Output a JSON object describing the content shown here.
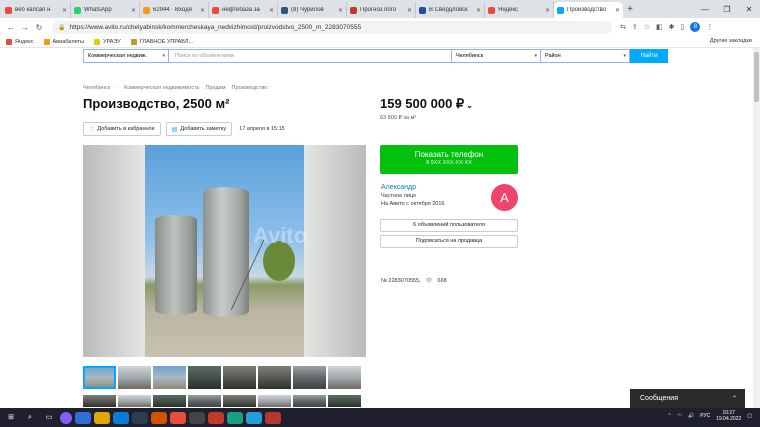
{
  "browser": {
    "tabs": [
      {
        "label": "веб капсап н",
        "color": "#e74c3c"
      },
      {
        "label": "WhatsApp",
        "color": "#25d366"
      },
      {
        "label": "62944 · Входя",
        "color": "#f39c12"
      },
      {
        "label": "нефтебаза за",
        "color": "#e74c3c"
      },
      {
        "label": "(8) Чурилов",
        "color": "#2a5885"
      },
      {
        "label": "Прогноз пого",
        "color": "#c0392b"
      },
      {
        "label": "В Свердловск",
        "color": "#1a4ea8"
      },
      {
        "label": "Яндекс",
        "color": "#e74c3c"
      },
      {
        "label": "Производство",
        "color": "#00aaff",
        "active": true
      }
    ],
    "new_tab": "+",
    "url": "https://www.avito.ru/chelyabinsk/kommercheskaya_nedvizhimost/proizvodstvo_2500_m_2283070555",
    "profile_letter": "8",
    "bookmarks": [
      {
        "label": "Яндекс",
        "color": "#e74c3c"
      },
      {
        "label": "Авиабилеты",
        "color": "#f39c12"
      },
      {
        "label": "УРАЭУ",
        "color": "#f1c40f"
      },
      {
        "label": "ГЛАВНОЕ УПРАВЛ...",
        "color": "#c49a2a"
      }
    ],
    "other_bookmarks": "Другие закладки"
  },
  "search": {
    "category": "Коммерческая недвиж.",
    "placeholder": "Поиск по объявлениям",
    "city": "Челябинск",
    "district": "Район",
    "button": "Найти"
  },
  "breadcrumbs": [
    "Челябинск",
    "·",
    "Коммерческая недвижимость",
    "Продам",
    "Производство"
  ],
  "listing": {
    "title": "Производство, 2500 м²",
    "price": "159 500 000 ₽",
    "price_per_m": "63 800 ₽ за м²",
    "favorite": "Добавить в избранное",
    "note": "Добавить заметку",
    "date": "17 апреля в 15:15",
    "watermark": "Avito",
    "id_text": "№ 2283070555,",
    "views": "668"
  },
  "contact": {
    "show_phone": "Показать телефон",
    "phone_mask": "8 9XX XXX-XX-XX",
    "seller_name": "Александр",
    "seller_type": "Частное лицо",
    "seller_since": "На Авито с октября 2016",
    "avatar_letter": "А",
    "listings_btn": "6 объявлений пользователя",
    "subscribe_btn": "Подписаться на продавца"
  },
  "notification": {
    "label": "Сообщения"
  },
  "system": {
    "lang": "РУС",
    "time": "10:27",
    "date": "19.04.2022"
  }
}
